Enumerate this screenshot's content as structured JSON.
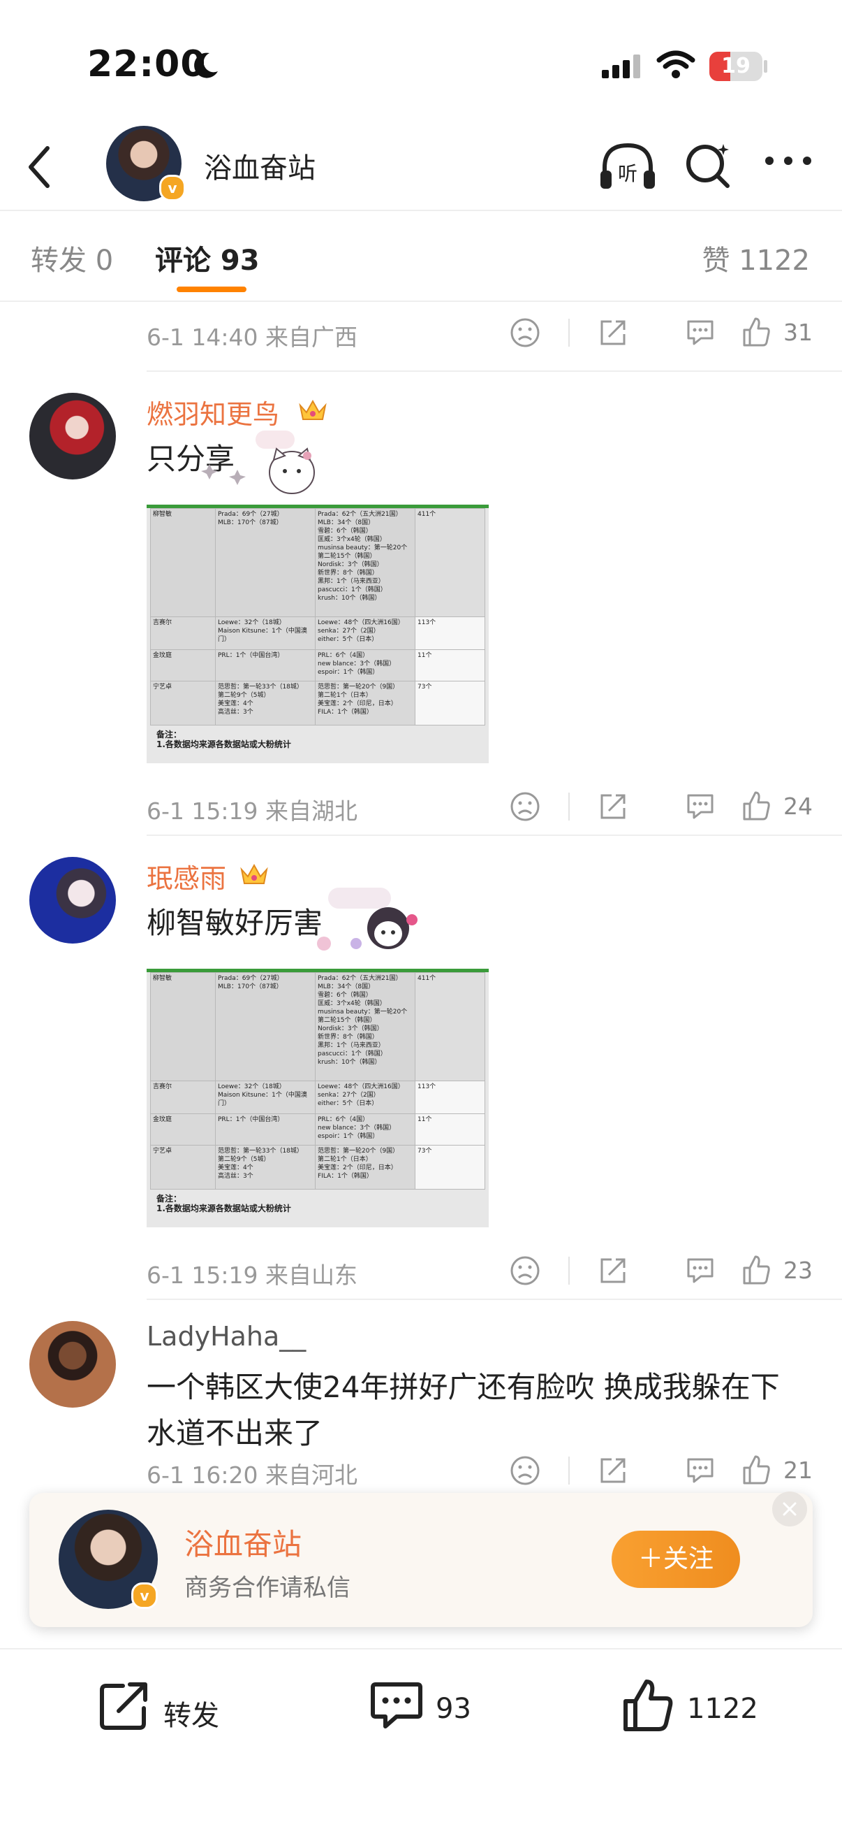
{
  "status_bar": {
    "time": "22:00",
    "battery": "19"
  },
  "header": {
    "title": "浴血奋站"
  },
  "tabs": {
    "repost": "转发 0",
    "comments": "评论 93",
    "likes": "赞 1122"
  },
  "top_row": {
    "meta": "6-1 14:40 来自广西",
    "likes": "31"
  },
  "comments": [
    {
      "username": "燃羽知更鸟",
      "text": "只分享",
      "meta": "6-1 15:19 来自湖北",
      "likes": "24"
    },
    {
      "username": "珉感雨",
      "text": "柳智敏好厉害",
      "meta": "6-1 15:19 来自山东",
      "likes": "23"
    },
    {
      "username": "LadyHaha__",
      "text": "一个韩区大使24年拼好广还有脸吹 换成我躲在下水道不出来了",
      "meta": "6-1 16:20 来自河北",
      "likes": "21"
    }
  ],
  "embedded_table": {
    "rows": [
      {
        "name": "柳智敏",
        "c2": "Prada：69个（27城）\nMLB：170个（87城）",
        "c3": "Prada：62个（五大洲21国）\nMLB：34个（8国）\n雪碧：6个（韩国）\n匡威：3个x4轮（韩国）\nmusinsa beauty：第一轮20个\n第二轮15个（韩国）\nNordisk：3个（韩国）\n新世界：8个（韩国）\n黑邦：1个（马来西亚）\npascucci：1个（韩国）\nkrush：10个（韩国）",
        "c4": "411个"
      },
      {
        "name": "吉赛尔",
        "c2": "Loewe：32个（18城）\nMaison Kitsune：1个（中国澳门）",
        "c3": "Loewe：48个（四大洲16国）\nsenka：27个（2国）\neither：5个（日本）",
        "c4": "113个"
      },
      {
        "name": "金玟庭",
        "c2": "PRL：1个（中国台湾）",
        "c3": "PRL：6个（4国）\nnew blance：3个（韩国）\nespoir：1个（韩国）",
        "c4": "11个"
      },
      {
        "name": "宁艺卓",
        "c2": "范思哲：第一轮33个（18城）\n第二轮9个（5城）\n美宝莲：4个\n高洁丝：3个",
        "c3": "范思哲：第一轮20个（9国）\n第二轮1个（日本）\n美宝莲：2个（印尼，日本）\nFILA：1个（韩国）",
        "c4": "73个"
      }
    ],
    "note_title": "备注：",
    "note_line": "1.各数据均来源各数据站或大粉统计"
  },
  "follow_card": {
    "name": "浴血奋站",
    "subtitle": "商务合作请私信",
    "button": "＋关注"
  },
  "bottom_bar": {
    "repost": "转发",
    "comments": "93",
    "likes": "1122"
  },
  "colors": {
    "accent": "#ff8200",
    "vip_name": "#eb7340",
    "follow_button": "#f59a2b"
  }
}
